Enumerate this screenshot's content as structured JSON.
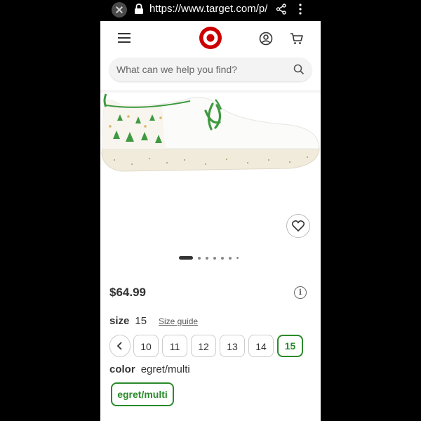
{
  "browser": {
    "url": "https://www.target.com/p/he"
  },
  "header": {
    "logo": "target-logo",
    "icons": [
      "hamburger-icon",
      "account-icon",
      "cart-icon"
    ]
  },
  "search": {
    "placeholder": "What can we help you find?"
  },
  "gallery": {
    "image": "white slip-on shoe with green laces and tree print heel",
    "total_images": 7,
    "active_index": 0
  },
  "product": {
    "price": "$64.99",
    "size_label": "size",
    "size_value": "15",
    "size_guide": "Size guide",
    "sizes": [
      "10",
      "11",
      "12",
      "13",
      "14",
      "15"
    ],
    "selected_size": "15",
    "color_label": "color",
    "color_value": "egret/multi",
    "colors": [
      "egret/multi"
    ]
  },
  "colors": {
    "brand": "#cc0000",
    "selected": "#2a8a2a"
  }
}
